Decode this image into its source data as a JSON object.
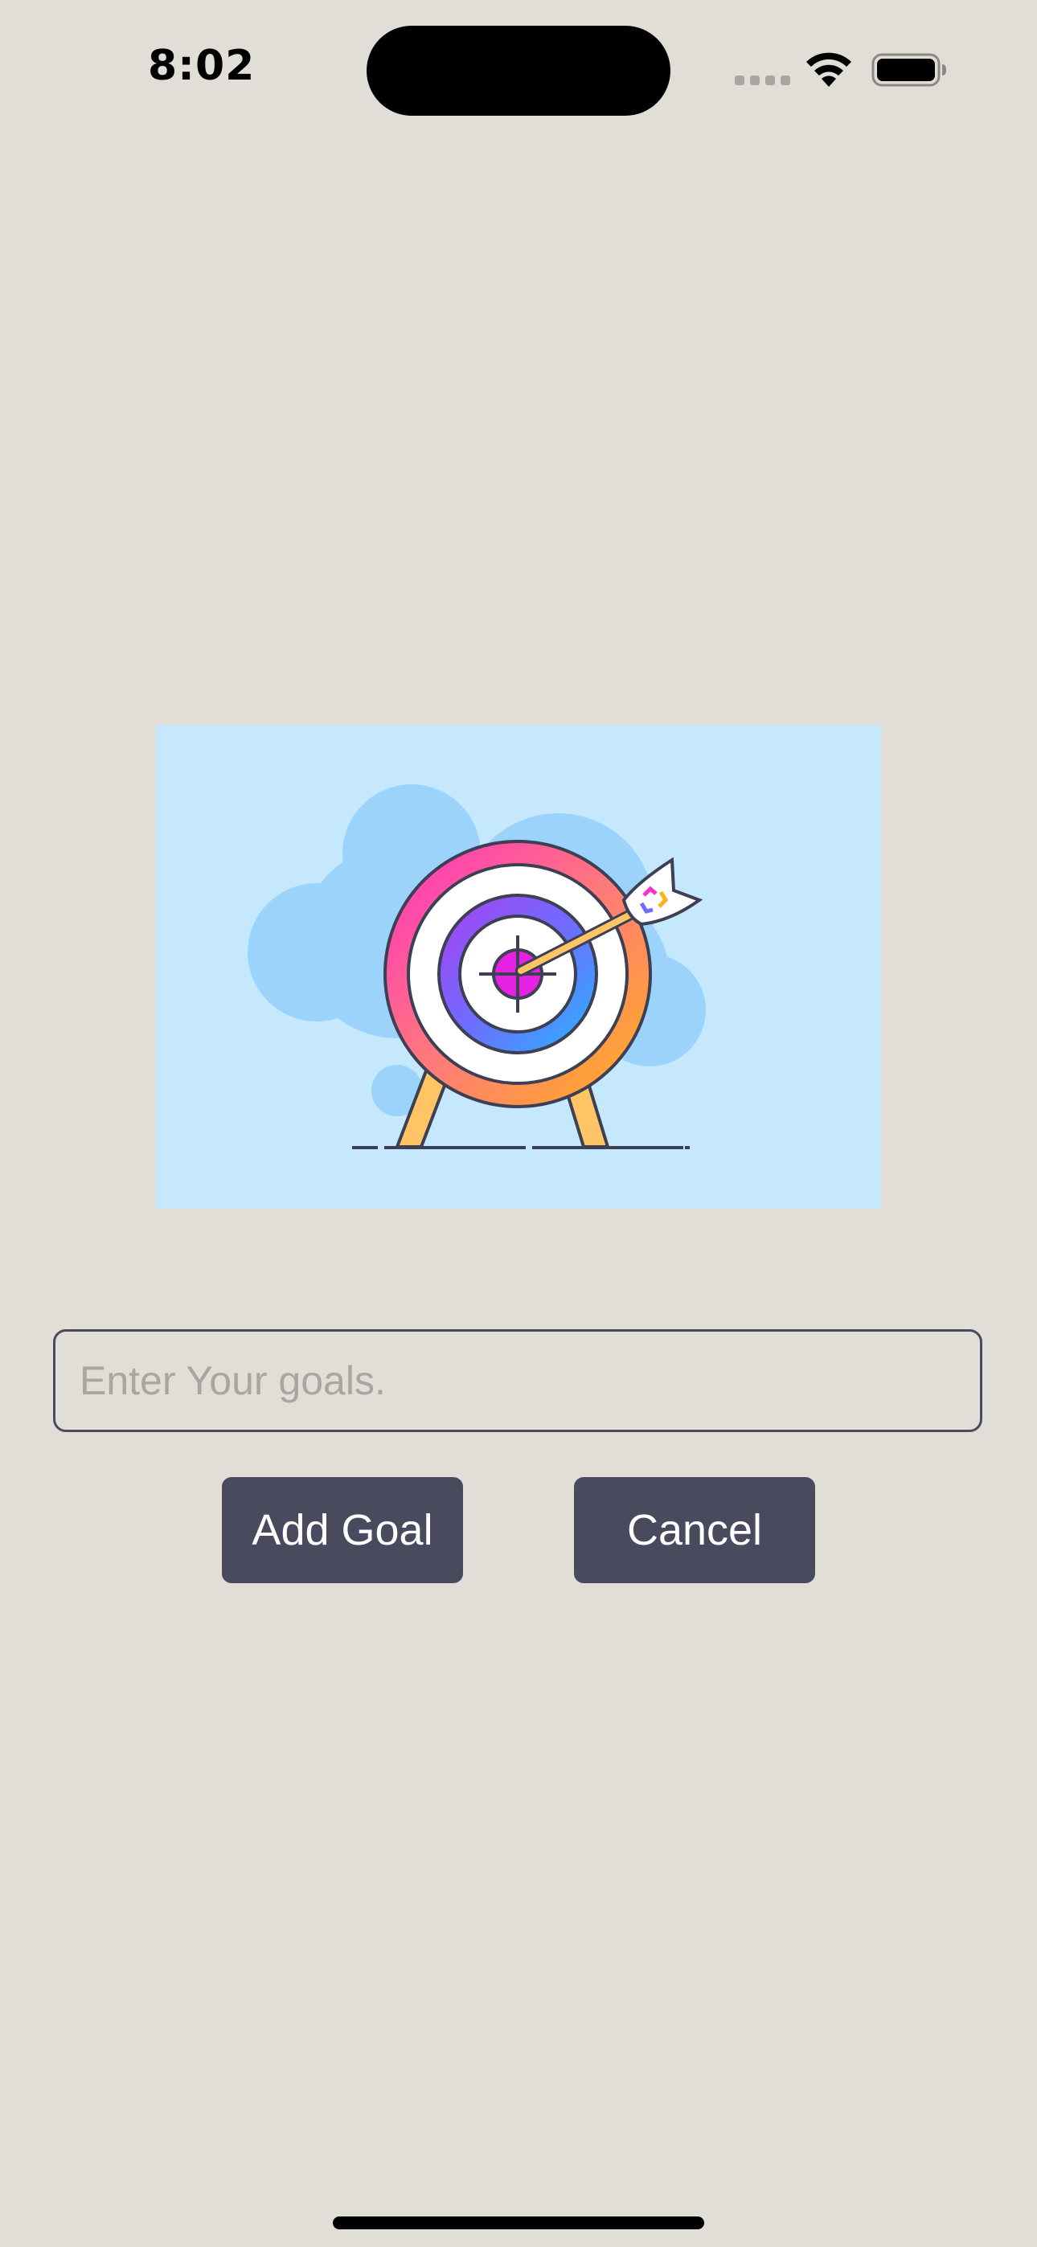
{
  "status_bar": {
    "time": "8:02",
    "icons": [
      "signal-dots-icon",
      "wifi-icon",
      "battery-icon"
    ]
  },
  "illustration": {
    "subject": "target-with-arrow-icon",
    "background_color": "#c6e8fd"
  },
  "goal_input": {
    "value": "",
    "placeholder": "Enter Your goals."
  },
  "buttons": {
    "add_goal_label": "Add Goal",
    "cancel_label": "Cancel",
    "color": "#4a4a5e"
  },
  "colors": {
    "background": "#e1ddd7",
    "button_text": "#ffffff"
  }
}
